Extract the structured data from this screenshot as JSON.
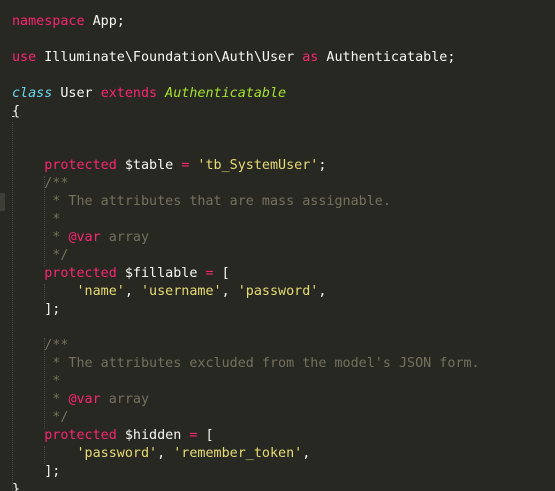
{
  "editor": {
    "theme_colors": {
      "background": "#272822",
      "foreground": "#f8f8f2",
      "keyword": "#f92672",
      "storage": "#66d9ef",
      "inherited_class": "#a6e22e",
      "string": "#e6db74",
      "comment": "#75715e"
    },
    "code": {
      "namespace_kw": "namespace",
      "namespace_name": " App;",
      "use_kw": "use",
      "use_path": " Illuminate\\Foundation\\Auth\\User ",
      "as_kw": "as",
      "alias": " Authenticatable;",
      "class_kw": "class",
      "class_name": " User ",
      "extends_kw": "extends",
      "parent_class": " Authenticatable",
      "open_brace": "{",
      "protected_kw": "protected",
      "table_var": " $table ",
      "equals": "=",
      "table_value": " 'tb_SystemUser'",
      "semicolon": ";",
      "doc_open": "/**",
      "doc1_text": " * The attributes that are mass assignable.",
      "doc_star": " *",
      "doc_var_prefix": " * ",
      "doc_var_tag": "@var",
      "doc_var_type": " array",
      "doc_close": " */",
      "fillable_var": " $fillable ",
      "array_open": " [",
      "fillable_items": [
        "'name'",
        "'username'",
        "'password'"
      ],
      "comma": ",",
      "array_close": "];",
      "doc2_text": " * The attributes excluded from the model's JSON form.",
      "hidden_var": " $hidden ",
      "hidden_items": [
        "'password'",
        "'remember_token'"
      ],
      "close_brace": "}"
    }
  }
}
